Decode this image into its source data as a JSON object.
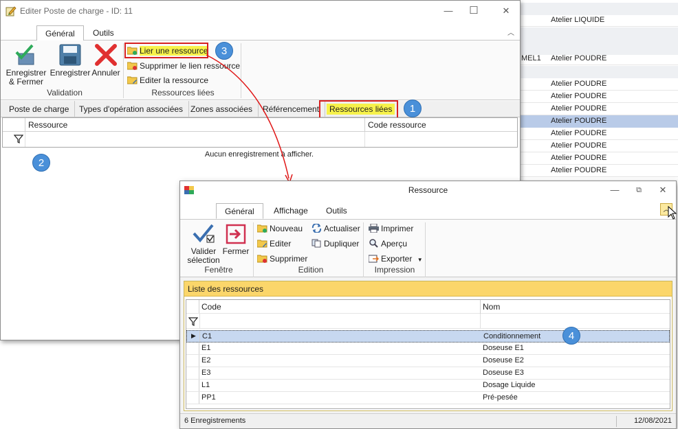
{
  "background_grid": {
    "rows": [
      {
        "code": "",
        "workshop": "Atelier LIQUIDE",
        "style": "line"
      },
      {
        "code": "",
        "workshop": "",
        "style": "shade"
      },
      {
        "code": "",
        "workshop": "",
        "style": "shade"
      },
      {
        "code": "MEL1",
        "workshop": "Atelier POUDRE",
        "style": "line"
      },
      {
        "code": "",
        "workshop": "",
        "style": "shade"
      },
      {
        "code": "",
        "workshop": "Atelier POUDRE",
        "style": "line"
      },
      {
        "code": "",
        "workshop": "Atelier POUDRE",
        "style": "line"
      },
      {
        "code": "",
        "workshop": "Atelier POUDRE",
        "style": "line"
      },
      {
        "code": "",
        "workshop": "Atelier POUDRE",
        "style": "sel"
      },
      {
        "code": "",
        "workshop": "Atelier POUDRE",
        "style": "line"
      },
      {
        "code": "",
        "workshop": "Atelier POUDRE",
        "style": "line"
      },
      {
        "code": "",
        "workshop": "Atelier POUDRE",
        "style": "line"
      },
      {
        "code": "",
        "workshop": "Atelier POUDRE",
        "style": "line"
      }
    ]
  },
  "window1": {
    "title": "Editer Poste de charge - ID: 11",
    "controls": {
      "minimize": "—",
      "maximize": "☐",
      "close": "✕"
    },
    "ribbon_tabs": [
      "Général",
      "Outils"
    ],
    "validation": {
      "save_close": "Enregistrer & Fermer",
      "save": "Enregistrer",
      "cancel": "Annuler",
      "group_label": "Validation"
    },
    "linked": {
      "link": "Lier une ressource",
      "unlink": "Supprimer le lien ressource",
      "edit": "Editer la ressource",
      "group_label": "Ressources liées"
    },
    "page_tabs": [
      "Poste de charge",
      "Types d'opération associées",
      "Zones associées",
      "Référencement",
      "Ressources liées"
    ],
    "grid": {
      "columns": [
        "Ressource",
        "Code ressource"
      ],
      "empty_message": "Aucun enregistrement à afficher."
    }
  },
  "callouts": [
    "1",
    "2",
    "3",
    "4"
  ],
  "window2": {
    "title": "Ressource",
    "ribbon_tabs": [
      "Général",
      "Affichage",
      "Outils"
    ],
    "fenetre": {
      "validate": "Valider sélection",
      "close": "Fermer",
      "group_label": "Fenêtre"
    },
    "edition": {
      "new": "Nouveau",
      "edit": "Editer",
      "delete": "Supprimer",
      "refresh": "Actualiser",
      "duplicate": "Dupliquer",
      "group_label": "Edition"
    },
    "impression": {
      "print": "Imprimer",
      "preview": "Aperçu",
      "export": "Exporter",
      "group_label": "Impression"
    },
    "list_title": "Liste des ressources",
    "columns": [
      "Code",
      "Nom"
    ],
    "rows": [
      {
        "code": "C1",
        "name": "Conditionnement",
        "selected": true
      },
      {
        "code": "E1",
        "name": "Doseuse E1",
        "selected": false
      },
      {
        "code": "E2",
        "name": "Doseuse E2",
        "selected": false
      },
      {
        "code": "E3",
        "name": "Doseuse E3",
        "selected": false
      },
      {
        "code": "L1",
        "name": "Dosage Liquide",
        "selected": false
      },
      {
        "code": "PP1",
        "name": "Pré-pesée",
        "selected": false
      }
    ],
    "status": {
      "count": "6 Enregistrements",
      "date": "12/08/2021"
    }
  },
  "colors": {
    "callout": "#4a90d9",
    "highlight": "#f7f24b",
    "red_box": "#d72020",
    "list_header": "#fbd66a",
    "selected_row": "#c7d8f0"
  }
}
